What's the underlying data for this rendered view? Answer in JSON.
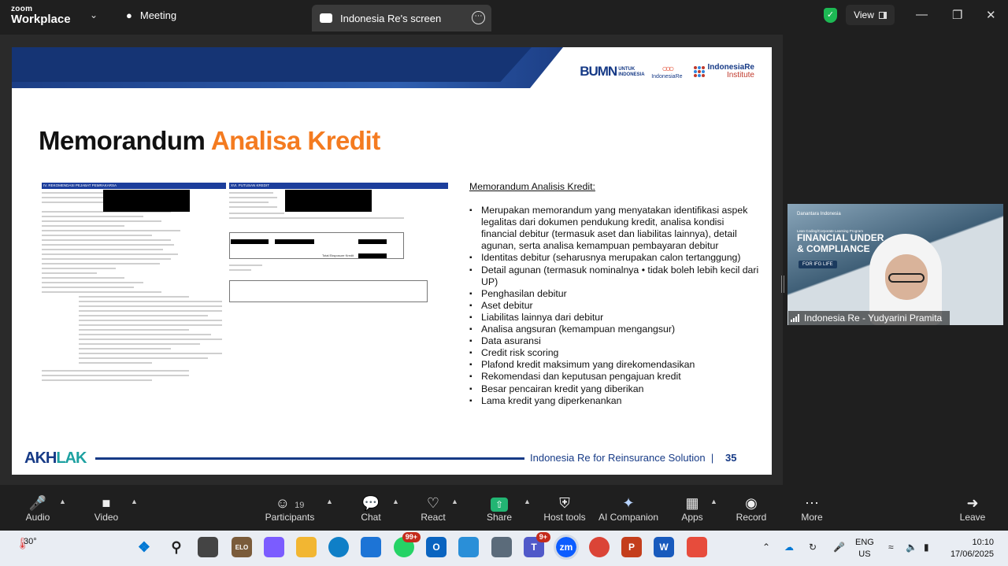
{
  "topbar": {
    "logo_line1": "zoom",
    "logo_line2": "Workplace",
    "meeting_label": "Meeting",
    "share_tab_label": "Indonesia Re's screen",
    "view_label": "View"
  },
  "slide": {
    "title_part1": "Memorandum",
    "title_part2": "Analisa Kredit",
    "logo_bumn": "BUMN",
    "logo_bumn_sub": "UNTUK INDONESIA",
    "logo_ir": "IndonesiaRe",
    "logo_iri_1": "IndonesiaRe",
    "logo_iri_2": "Institute",
    "doc1_header": "IV. REKOMENDASI PEJABAT PEMRAKARSA",
    "doc2_header": "XVI. PUTUSAN KREDIT",
    "doc2_total_label": "Total Eksposure Kredit",
    "heading": "Memorandum Analisis Kredit:",
    "bullets": [
      "Merupakan memorandum yang menyatakan identifikasi aspek legalitas dari dokumen pendukung kredit, analisa kondisi financial debitur (termasuk aset dan liabilitas lainnya), detail agunan, serta analisa kemampuan pembayaran debitur",
      "Identitas debitur (seharusnya merupakan calon tertanggung)",
      "Detail agunan (termasuk nominalnya • tidak boleh lebih kecil dari UP)",
      "Penghasilan debitur",
      "Aset debitur",
      "Liabilitas lainnya dari debitur",
      "Analisa angsuran (kemampuan mengangsur)",
      "Data asuransi",
      "Credit risk scoring",
      "Plafond kredit maksimum yang direkomendasikan",
      "Rekomendasi dan keputusan pengajuan kredit",
      "Besar pencairan kredit yang diberikan",
      "Lama kredit yang diperkenankan"
    ],
    "footer_brand_1": "AKH",
    "footer_brand_2": "LAK",
    "footer_text": "Indonesia Re for Reinsurance Solution",
    "footer_sep": "|",
    "page_number": "35"
  },
  "video": {
    "line_small": "Danantara Indonesia",
    "program": "Lean Coding/Corporate Learning Program",
    "headline1": "FINANCIAL UNDER",
    "headline2": "& COMPLIANCE",
    "badge": "FOR IFG LIFE",
    "participant_name": "Indonesia Re - Yudyarini Pramita"
  },
  "controls": {
    "audio": "Audio",
    "video": "Video",
    "participants": "Participants",
    "participants_count": "19",
    "chat": "Chat",
    "react": "React",
    "share": "Share",
    "host_tools": "Host tools",
    "ai_companion": "AI Companion",
    "apps": "Apps",
    "record": "Record",
    "more": "More",
    "leave": "Leave"
  },
  "taskbar": {
    "temperature": "30°",
    "lang1": "ENG",
    "lang2": "US",
    "time": "10:10",
    "date": "17/06/2025",
    "whatsapp_badge": "99+",
    "teams_badge": "9+",
    "elo_label": "ELO"
  }
}
